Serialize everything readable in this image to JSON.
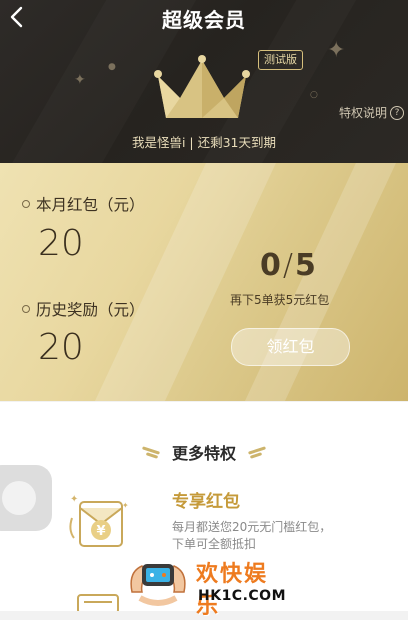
{
  "header": {
    "title": "超级会员",
    "badge": "测试版",
    "member_status": "我是怪兽i  |  还剩31天到期",
    "privilege_link": "特权说明",
    "help_glyph": "?"
  },
  "stats": {
    "monthly_label": "本月红包（元）",
    "monthly_value": "20",
    "history_label": "历史奖励（元）",
    "history_value": "20",
    "progress_done": "0",
    "progress_sep": "/",
    "progress_total": "5",
    "progress_hint": "再下5单获5元红包",
    "claim_label": "领红包"
  },
  "privileges": {
    "section_title": "更多特权",
    "items": [
      {
        "title": "专享红包",
        "desc_line1": "每月都送您20元无门槛红包，",
        "desc_line2": "下单可全额抵扣",
        "icon_glyph": "¥"
      }
    ]
  },
  "watermark": {
    "title": "欢快娱乐",
    "url": "HK1C.COM"
  },
  "colors": {
    "hero_bg": "#2e2b28",
    "gold": "#e8d79f",
    "accent_gold": "#c59a3a",
    "watermark_orange": "#ee7b1f"
  }
}
